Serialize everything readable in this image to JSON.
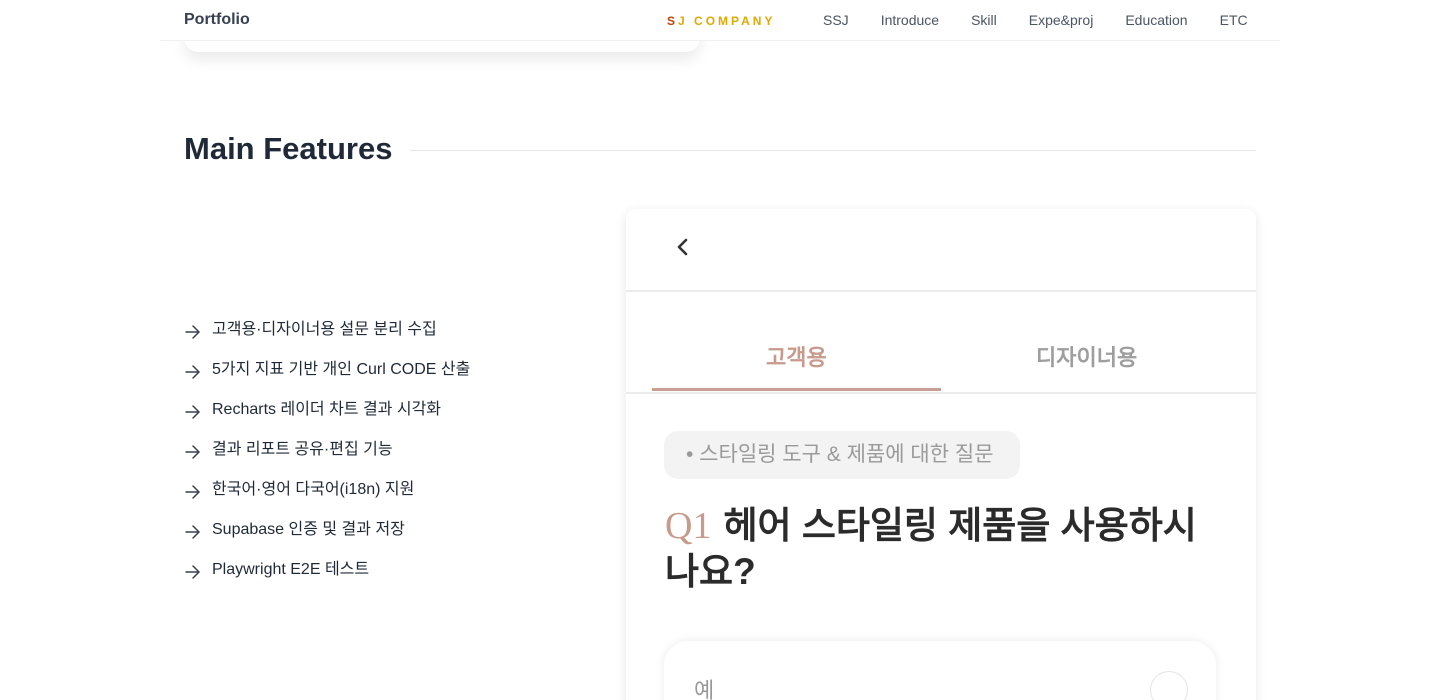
{
  "header": {
    "brand": "Portfolio",
    "company_first": "S",
    "company_rest": "J COMPANY",
    "nav": [
      "SSJ",
      "Introduce",
      "Skill",
      "Expe&proj",
      "Education",
      "ETC"
    ]
  },
  "section": {
    "title": "Main Features"
  },
  "features": [
    "고객용·디자이너용 설문 분리 수집",
    "5가지 지표 기반 개인 Curl CODE 산출",
    "Recharts 레이더 차트 결과 시각화",
    "결과 리포트 공유·편집 기능",
    "한국어·영어 다국어(i18n) 지원",
    "Supabase 인증 및 결과 저장",
    "Playwright E2E 테스트"
  ],
  "mockup": {
    "tabs": [
      "고객용",
      "디자이너용"
    ],
    "chip": "• 스타일링 도구 & 제품에 대한 질문",
    "question_number": "Q1",
    "question_text": "헤어 스타일링 제품을 사용하시나요?",
    "answer_label": "예"
  },
  "colors": {
    "accent": "#c79a8c",
    "company": "#e0a800"
  }
}
